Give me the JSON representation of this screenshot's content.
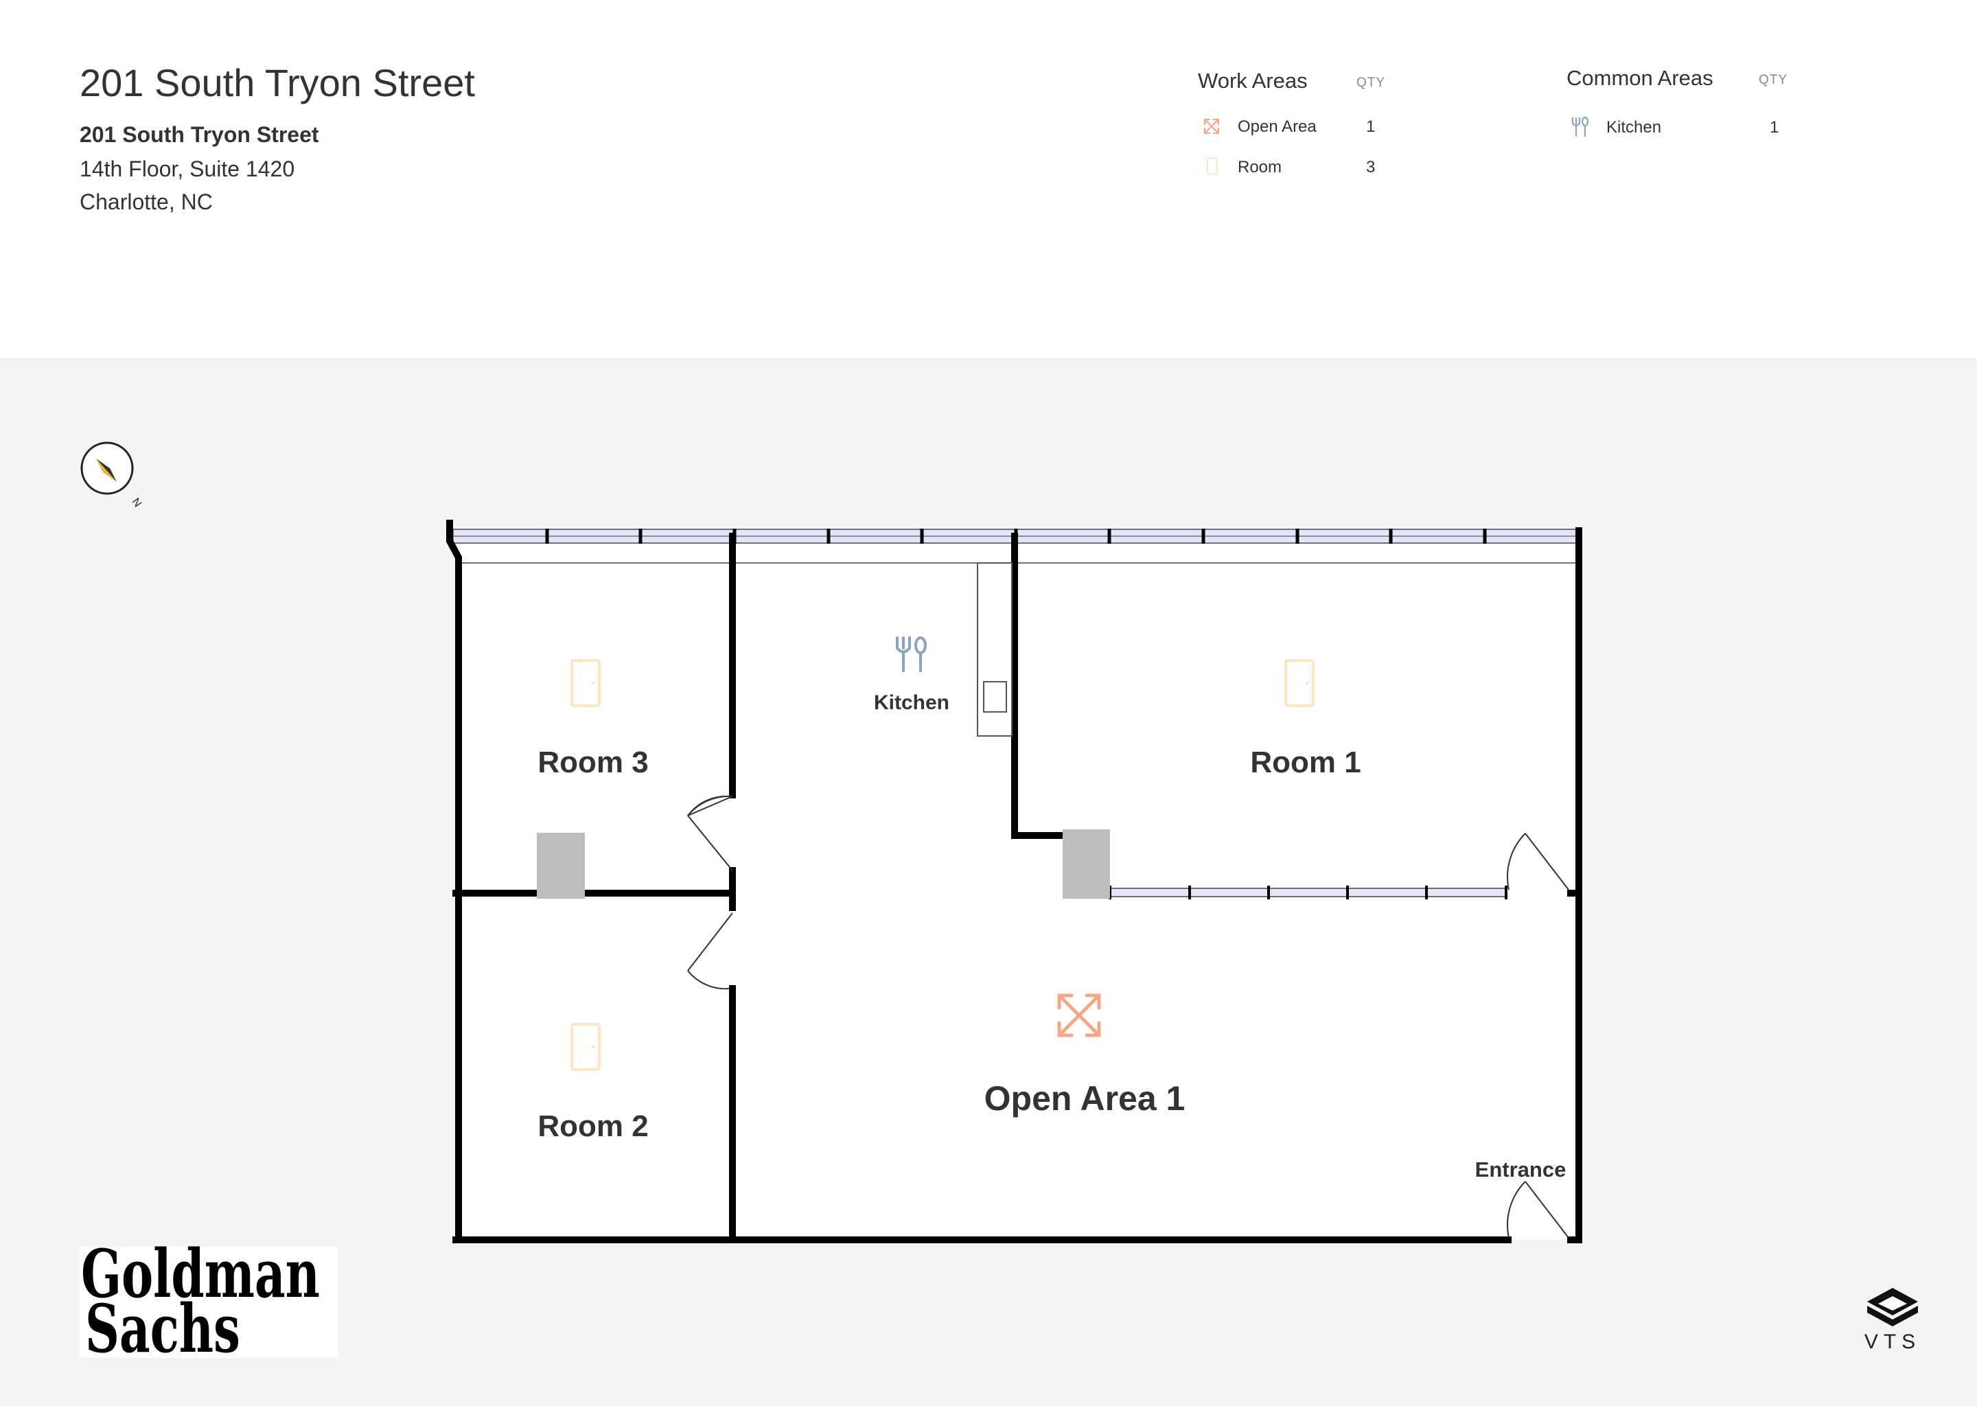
{
  "header": {
    "title": "201 South Tryon Street",
    "address_line1": "201 South Tryon Street",
    "address_line2": "14th Floor, Suite 1420",
    "address_line3": "Charlotte, NC"
  },
  "legend": {
    "work_areas": {
      "heading": "Work Areas",
      "qty_label": "QTY",
      "items": [
        {
          "icon": "open-area-arrows-icon",
          "label": "Open Area",
          "qty": "1"
        },
        {
          "icon": "door-icon",
          "label": "Room",
          "qty": "3"
        }
      ]
    },
    "common_areas": {
      "heading": "Common Areas",
      "qty_label": "QTY",
      "items": [
        {
          "icon": "fork-knife-icon",
          "label": "Kitchen",
          "qty": "1"
        }
      ]
    }
  },
  "floorplan": {
    "rooms": {
      "room3": "Room 3",
      "room2": "Room 2",
      "room1": "Room 1",
      "kitchen": "Kitchen",
      "open_area": "Open Area 1",
      "entrance": "Entrance"
    },
    "compass_label": "N"
  },
  "colors": {
    "wall": "#000000",
    "window": "#e4e6f5",
    "column": "#bdbdbd",
    "room_icon": "#fde6c4",
    "open_area_icon": "#f4a885",
    "kitchen_icon": "#8aa3c0",
    "plan_background": "#f4f4f4"
  },
  "logos": {
    "goldman_sachs": [
      "Goldman",
      "Sachs"
    ],
    "vts": "VTS"
  }
}
